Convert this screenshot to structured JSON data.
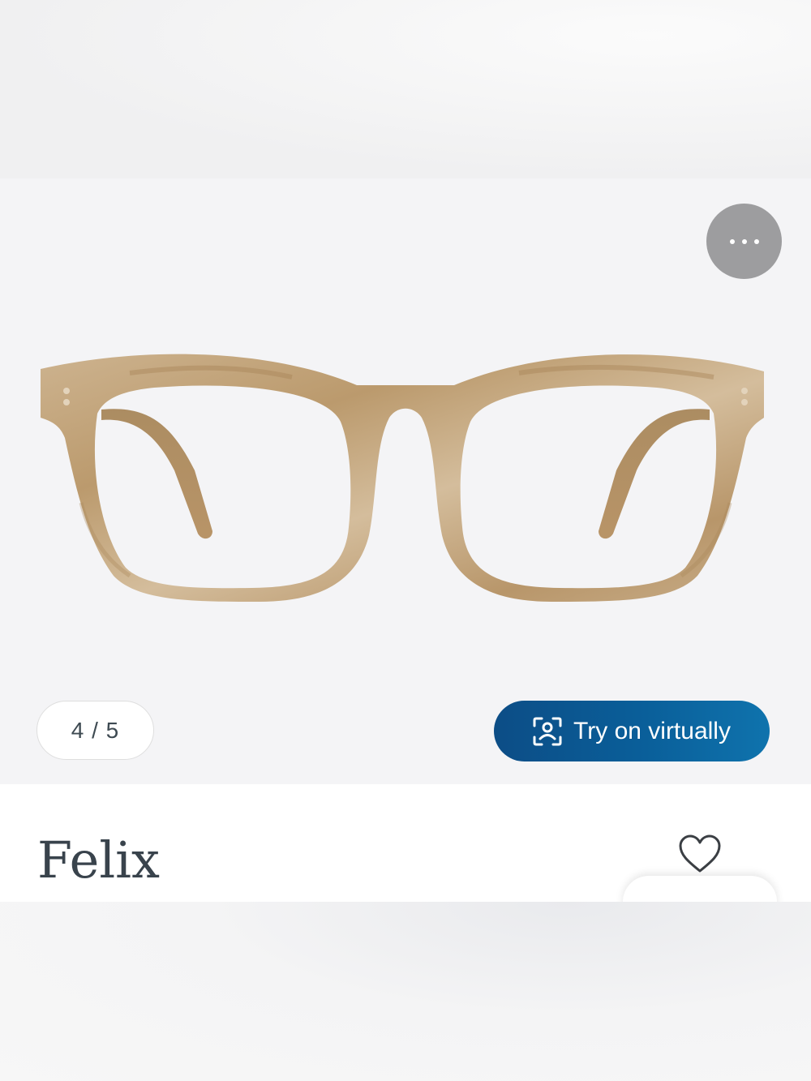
{
  "gallery": {
    "counter_text": "4 / 5",
    "more_icon": "ellipsis-icon",
    "try_on_label": "Try on virtually",
    "try_on_icon": "face-scan-icon",
    "accent_color": "#0b5a95"
  },
  "product": {
    "name": "Felix",
    "favorite_icon": "heart-outline-icon"
  }
}
